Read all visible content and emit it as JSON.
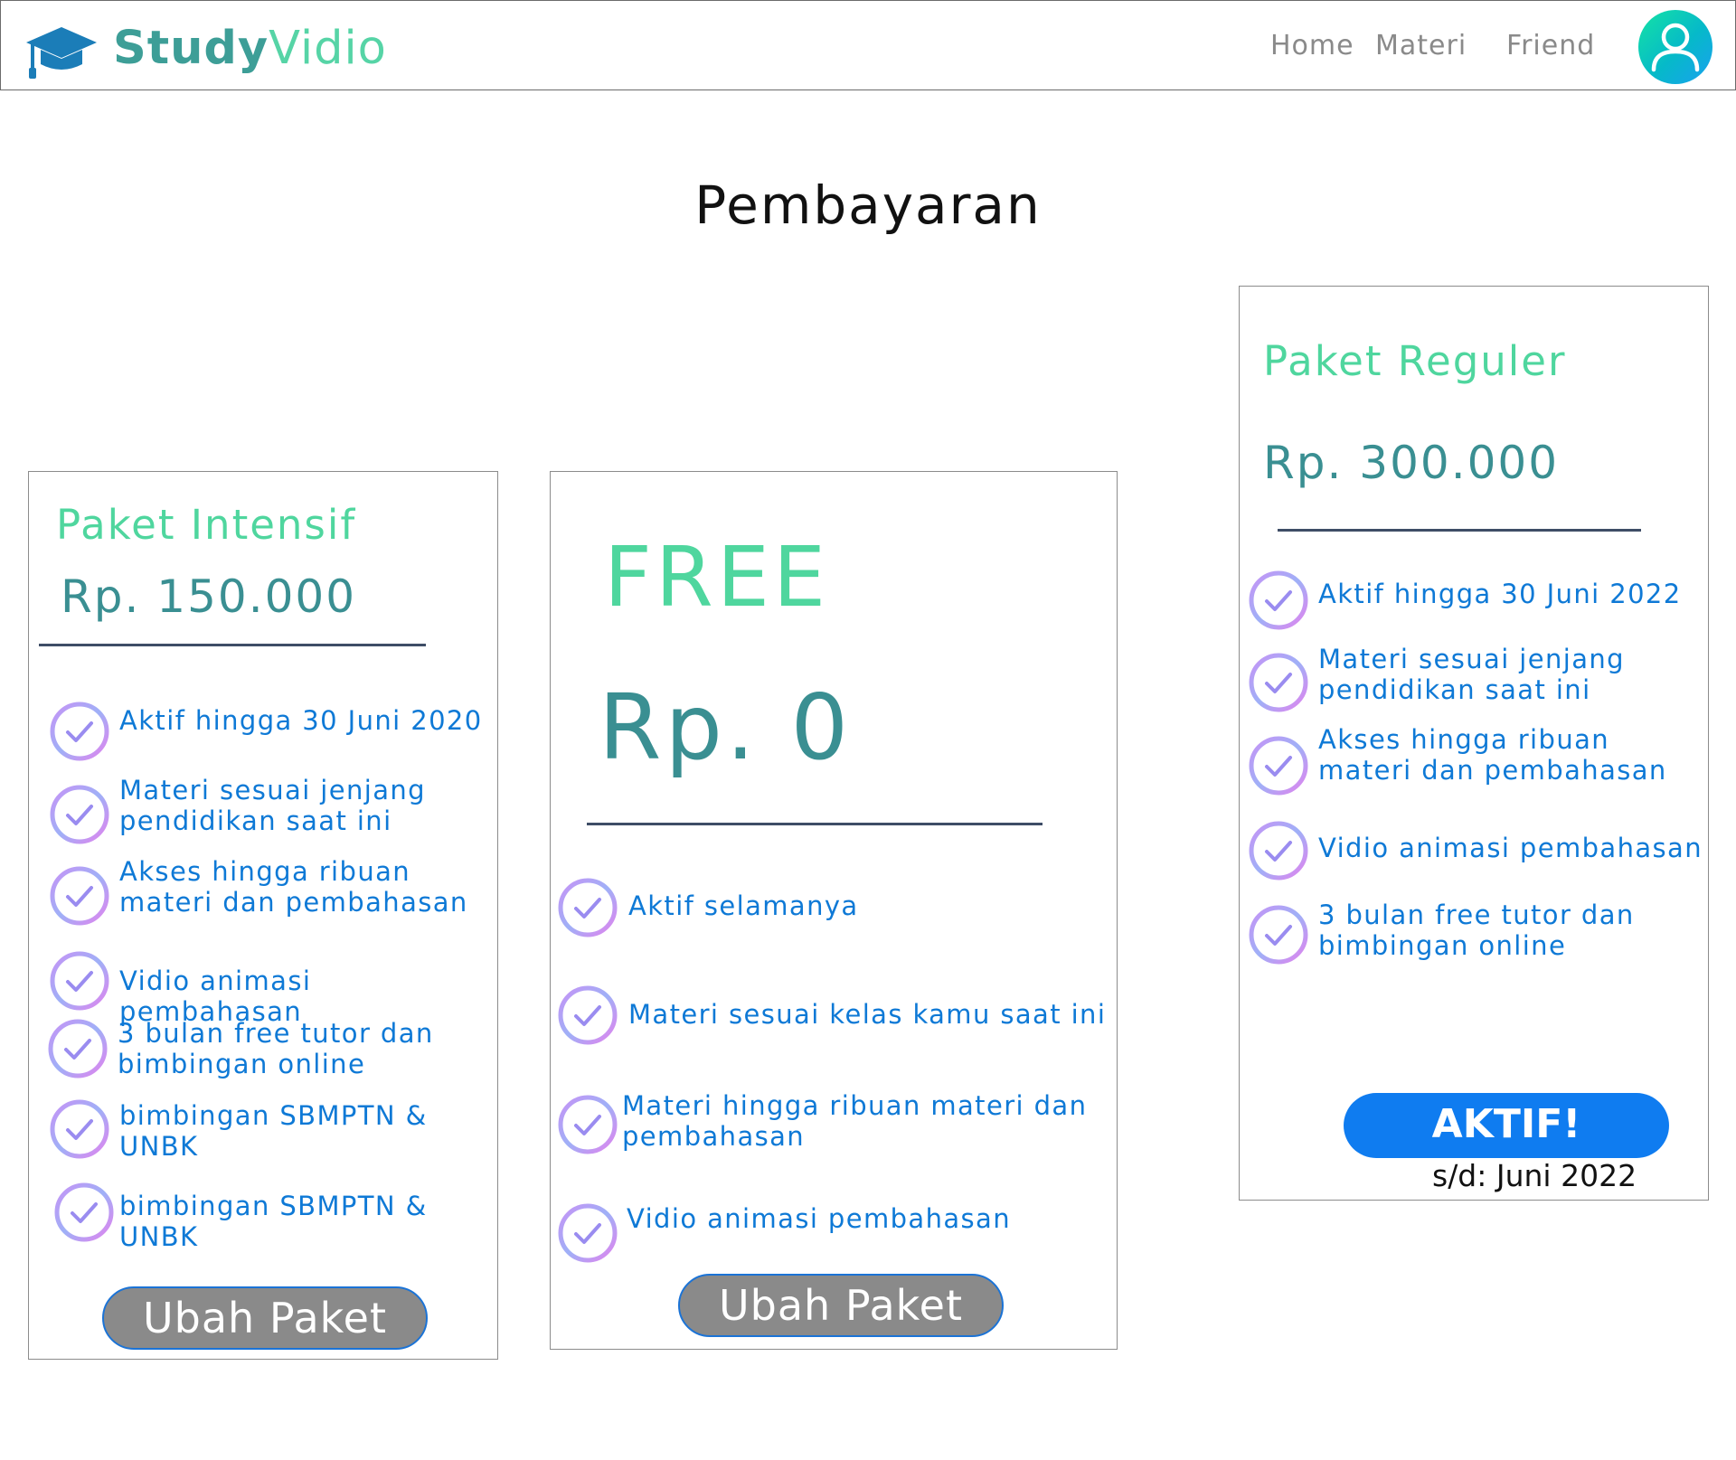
{
  "header": {
    "brand_bold": "Study",
    "brand_light": "Vidio",
    "nav": [
      {
        "label": "Home"
      },
      {
        "label": "Materi"
      },
      {
        "label": "Friend"
      }
    ]
  },
  "page": {
    "title": "Pembayaran"
  },
  "plans": {
    "intensif": {
      "title": "Paket Intensif",
      "price": "Rp. 150.000",
      "features": [
        {
          "text": "Aktif hingga 30 Juni 2020"
        },
        {
          "text": "Materi sesuai jenjang pendidikan saat ini"
        },
        {
          "text": "Akses hingga ribuan materi dan pembahasan"
        },
        {
          "text": "Vidio animasi pembahasan"
        },
        {
          "text": "3 bulan free tutor dan bimbingan online"
        },
        {
          "text": "bimbingan SBMPTN & UNBK"
        },
        {
          "text": "bimbingan SBMPTN & UNBK"
        }
      ],
      "button": "Ubah Paket"
    },
    "free": {
      "title": "FREE",
      "price": "Rp. 0",
      "features": [
        {
          "text": "Aktif selamanya"
        },
        {
          "text": "Materi sesuai kelas kamu saat ini"
        },
        {
          "text": "Materi hingga ribuan materi dan pembahasan"
        },
        {
          "text": "Vidio animasi pembahasan"
        }
      ],
      "button": "Ubah Paket"
    },
    "reguler": {
      "title": "Paket Reguler",
      "price": "Rp. 300.000",
      "features": [
        {
          "text": "Aktif hingga 30 Juni 2022"
        },
        {
          "text": "Materi sesuai jenjang pendidikan saat ini"
        },
        {
          "text": "Akses hingga ribuan materi dan pembahasan"
        },
        {
          "text": "Vidio animasi pembahasan"
        },
        {
          "text": "3 bulan free tutor dan bimbingan online"
        }
      ],
      "button": "AKTIF!",
      "active_until": "s/d: Juni 2022"
    }
  },
  "colors": {
    "accent_blue": "#0f7cf0",
    "plan_title_green": "#4fd69e",
    "price_teal": "#3a8f92",
    "feature_text": "#0e79d6"
  },
  "icons": {
    "logo": "graduation-cap-icon",
    "avatar": "user-icon",
    "feature": "check-circle-icon"
  }
}
